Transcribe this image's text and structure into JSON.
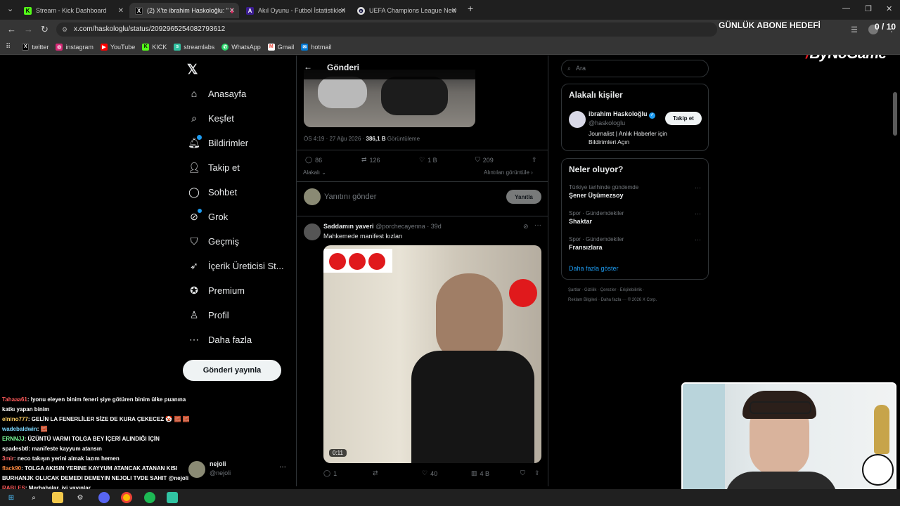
{
  "browser": {
    "tabs": [
      {
        "title": "Stream - Kick Dashboard",
        "icon": "kick-icon"
      },
      {
        "title": "(2) X'te ibrahim Haskoloğlu: \"",
        "icon": "x-icon"
      },
      {
        "title": "Akıl Oyunu - Futbol İstatistikleri",
        "icon": "ao-icon"
      },
      {
        "title": "UEFA Champions League New",
        "icon": "globe-icon"
      }
    ],
    "url": "x.com/haskologlu/status/2092965254082793612",
    "bookmarks": [
      {
        "label": "twitter",
        "icon": "x-icon"
      },
      {
        "label": "instagram",
        "icon": "instagram-icon"
      },
      {
        "label": "YouTube",
        "icon": "youtube-icon"
      },
      {
        "label": "KICK",
        "icon": "kick-icon"
      },
      {
        "label": "streamlabs",
        "icon": "streamlabs-icon"
      },
      {
        "label": "WhatsApp",
        "icon": "whatsapp-icon"
      },
      {
        "label": "Gmail",
        "icon": "gmail-icon"
      },
      {
        "label": "hotmail",
        "icon": "hotmail-icon"
      }
    ]
  },
  "overlay": {
    "goal_title": "GÜNLÜK ABONE HEDEFİ",
    "goal_value": "0 / 10",
    "brand": "ByNoGame"
  },
  "nav": {
    "items": [
      {
        "label": "Anasayfa",
        "icon": "home-icon"
      },
      {
        "label": "Keşfet",
        "icon": "search-icon"
      },
      {
        "label": "Bildirimler",
        "icon": "bell-icon"
      },
      {
        "label": "Takip et",
        "icon": "follow-icon"
      },
      {
        "label": "Sohbet",
        "icon": "chat-icon"
      },
      {
        "label": "Grok",
        "icon": "grok-icon"
      },
      {
        "label": "Geçmiş",
        "icon": "bookmark-icon"
      },
      {
        "label": "İçerik Üreticisi St...",
        "icon": "rocket-icon"
      },
      {
        "label": "Premium",
        "icon": "premium-icon"
      },
      {
        "label": "Profil",
        "icon": "profile-icon"
      },
      {
        "label": "Daha fazla",
        "icon": "more-icon"
      }
    ],
    "post_button": "Gönderi yayınla",
    "account": {
      "name": "nejoli",
      "handle": "@nejoli"
    }
  },
  "post": {
    "header_title": "Gönderi",
    "time": "ÖS 4:19 · 27 Ağu 2026 ·",
    "views": "386,1 B",
    "views_label": "Görüntüleme",
    "replies": "86",
    "reposts": "126",
    "likes": "1 B",
    "bookmarks": "209",
    "sort_label": "Alakalı",
    "quotes_label": "Alıntıları görüntüle",
    "reply_placeholder": "Yanıtını gönder",
    "reply_button": "Yanıtla"
  },
  "reply": {
    "name": "Saddamın yaveri",
    "handle": "@porchecayenna",
    "age": "· 39d",
    "text": "Mahkemede manifest kızları",
    "video_duration": "0:11",
    "replies": "1",
    "likes": "40",
    "views": "4 B"
  },
  "sidebar": {
    "search_placeholder": "Ara",
    "related_title": "Alakalı kişiler",
    "person": {
      "name": "ibrahim Haskoloğlu",
      "handle": "@haskologlu",
      "bio": "Journalist | Anlık Haberler için Bildirimleri Açın",
      "follow": "Takip et"
    },
    "trends_title": "Neler oluyor?",
    "trends": [
      {
        "category": "Türkiye tarihinde gündemde",
        "name": "Şener Üşümezsoy"
      },
      {
        "category": "Spor · Gündemdekiler",
        "name": "Shaktar"
      },
      {
        "category": "Spor · Gündemdekiler",
        "name": "Fransızlara"
      }
    ],
    "show_more": "Daha fazla göster",
    "footer_line1": "Şartlar  ·  Gizlilik  ·  Çerezler  ·  Erişilebilirlik  ·",
    "footer_line2": "Reklam Bilgileri  ·  Daha fazla ···  © 2026 X Corp."
  },
  "chat": [
    {
      "user": "Tahaaa61",
      "color": "#ff5a5a",
      "text": ": lyonu eleyen binim feneri şiye götüren binim ülke puanına katkı yapan binim"
    },
    {
      "user": "elnino777",
      "color": "#ffd166",
      "text": ": GELİN LA FENERLİLER SİZE DE KURA ÇEKECEZ 🤡 🧱 🧱"
    },
    {
      "user": "wadebaldwin",
      "color": "#7bd8ff",
      "text": ": 🧱"
    },
    {
      "user": "ERNNJJ",
      "color": "#7dff9c",
      "text": ": ÜZÜNTÜ VARMI TOLGA BEY İÇERİ ALINDIĞI İÇİN"
    },
    {
      "user": "spadesbtl",
      "color": "#ffffff",
      "text": ": manifeste kayyum atansın"
    },
    {
      "user": "3mir",
      "color": "#ff6666",
      "text": ": neco takışın yerini almak lazım hemen"
    },
    {
      "user": "flack90",
      "color": "#ff8c42",
      "text": ": TOLGA AKISIN YERINE KAYYUM ATANCAK ATANAN KISI BURHANJK OLUCAK DEMEDI DEMEYIN NEJOLI TVDE SAHIT @nejoli"
    },
    {
      "user": "RABLES",
      "color": "#ff5a5a",
      "text": ": Merhabalar, iyi yayınlar"
    }
  ],
  "colors": {
    "x_blue": "#1d9bf0",
    "verified": "#1d9bf0",
    "background": "#000000",
    "border": "#2f3336"
  }
}
